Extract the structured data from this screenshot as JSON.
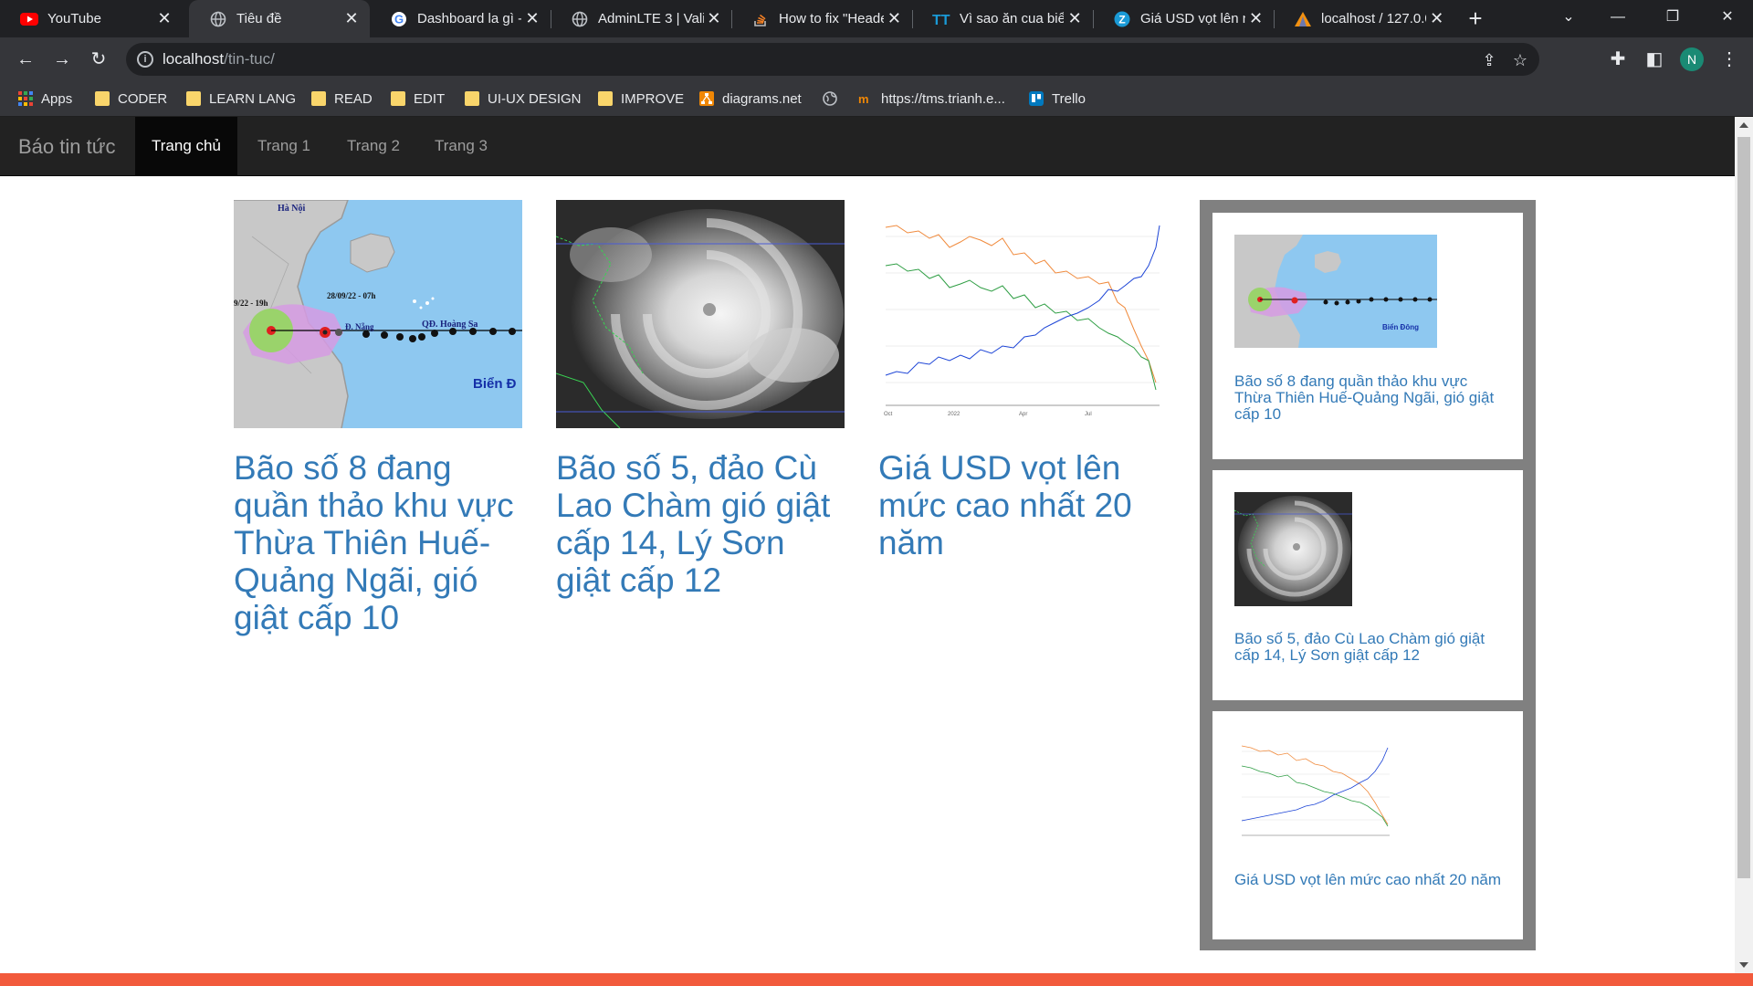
{
  "browser": {
    "tabs": [
      {
        "title": "YouTube",
        "icon": "youtube-icon",
        "active": false
      },
      {
        "title": "Tiêu đề",
        "icon": "globe-icon",
        "active": true
      },
      {
        "title": "Dashboard la gì -",
        "icon": "google-icon",
        "active": false
      },
      {
        "title": "AdminLTE 3 | Valic",
        "icon": "globe-icon",
        "active": false
      },
      {
        "title": "How to fix \"Heade",
        "icon": "stackoverflow-icon",
        "active": false
      },
      {
        "title": "Vì sao ăn cua biể",
        "icon": "tinhte-icon",
        "active": false
      },
      {
        "title": "Giá USD vọt lên n",
        "icon": "zing-icon",
        "active": false
      },
      {
        "title": "localhost / 127.0.0",
        "icon": "phpmyadmin-icon",
        "active": false
      }
    ],
    "url_host": "localhost",
    "url_path": "/tin-tuc/",
    "profile_initial": "N",
    "bookmarks": [
      {
        "label": "Apps",
        "icon": "apps-grid-icon"
      },
      {
        "label": "CODER",
        "icon": "folder-icon"
      },
      {
        "label": "LEARN LANG",
        "icon": "folder-icon"
      },
      {
        "label": "READ",
        "icon": "folder-icon"
      },
      {
        "label": "EDIT",
        "icon": "folder-icon"
      },
      {
        "label": "UI-UX DESIGN",
        "icon": "folder-icon"
      },
      {
        "label": "IMPROVE",
        "icon": "folder-icon"
      },
      {
        "label": "diagrams.net",
        "icon": "drawio-icon"
      },
      {
        "label": "",
        "icon": "globe-icon"
      },
      {
        "label": "https://tms.trianh.e...",
        "icon": "tms-icon"
      },
      {
        "label": "Trello",
        "icon": "trello-icon"
      }
    ]
  },
  "site": {
    "brand": "Báo tin tức",
    "nav": [
      {
        "label": "Trang chủ",
        "active": true
      },
      {
        "label": "Trang 1",
        "active": false
      },
      {
        "label": "Trang 2",
        "active": false
      },
      {
        "label": "Trang 3",
        "active": false
      }
    ],
    "articles": [
      {
        "title": "Bão số 8 đang quần thảo khu vực Thừa Thiên Huế-Quảng Ngãi, gió giật cấp 10",
        "image": "storm-track-map",
        "map_labels": {
          "city": "Hà Nội",
          "time1": "28/09/22 - 07h",
          "time0": "9/22 - 19h",
          "danang": "Đ. Nẵng",
          "hoangsa": "QĐ. Hoàng Sa",
          "sea": "Biển Đ"
        }
      },
      {
        "title": "Bão số 5, đảo Cù Lao Chàm gió giật cấp 14, Lý Sơn giật cấp 12",
        "image": "satellite-storm"
      },
      {
        "title": "Giá USD vọt lên mức cao nhất 20 năm",
        "image": "usd-price-chart"
      }
    ],
    "sidebar": [
      {
        "title": "Bão số 8 đang quần thảo khu vực Thừa Thiên Huế-Quảng Ngãi, gió giật cấp 10",
        "image": "storm-track-map",
        "map_labels": {
          "sea": "Biển Đông"
        }
      },
      {
        "title": "Bão số 5, đảo Cù Lao Chàm gió giật cấp 14, Lý Sơn giật cấp 12",
        "image": "satellite-storm"
      },
      {
        "title": "Giá USD vọt lên mức cao nhất 20 năm",
        "image": "usd-price-chart"
      }
    ]
  },
  "colors": {
    "link": "#337ab7",
    "navbar": "#222222",
    "sidebar_bg": "#808080",
    "footer_strip": "#f25a3c"
  }
}
